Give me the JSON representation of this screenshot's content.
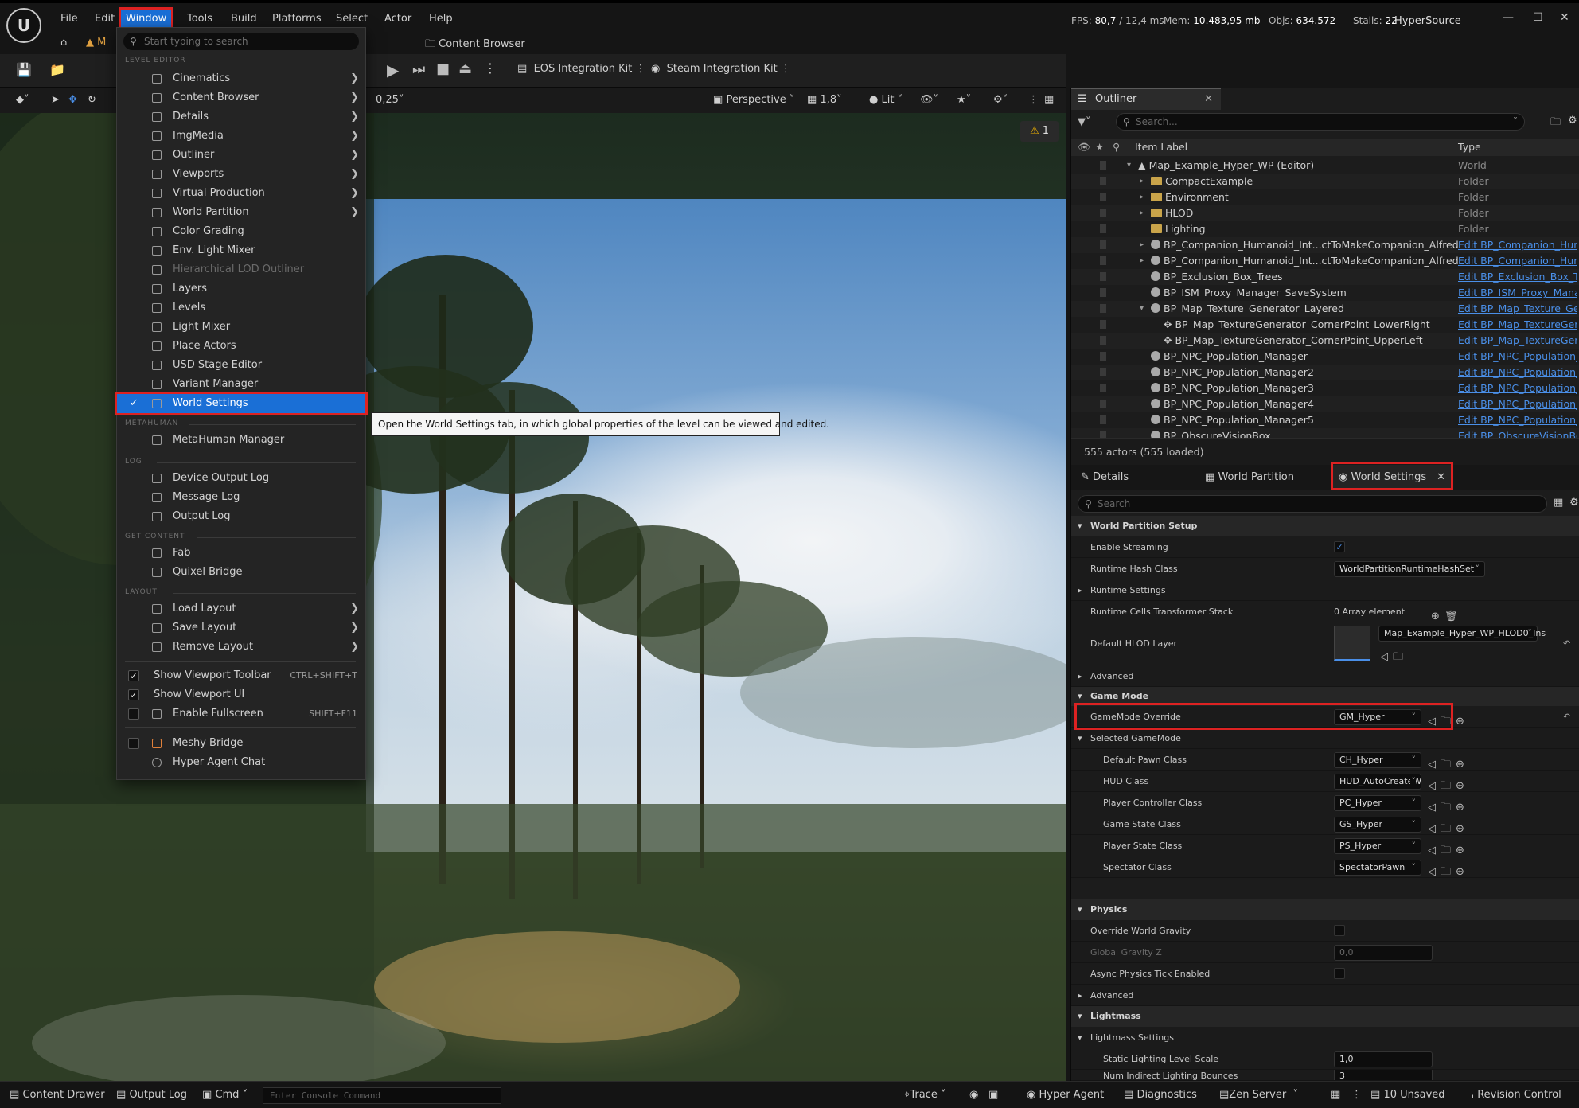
{
  "menubar": {
    "logo": "U",
    "items": [
      "File",
      "Edit",
      "Window",
      "Tools",
      "Build",
      "Platforms",
      "Select",
      "Actor",
      "Help"
    ],
    "stats": {
      "fps_label": "FPS:",
      "fps": "80,7",
      "ms": "/ 12,4 ms",
      "mem_label": "Mem:",
      "mem": "10.483,95 mb",
      "objs_label": "Objs:",
      "objs": "634.572",
      "stalls_label": "Stalls:",
      "stalls": "22"
    },
    "project": "HyperSource"
  },
  "tabs_row": {
    "map_tab": "M",
    "content_browser": "Content Browser"
  },
  "toolbar": {
    "eos": "EOS Integration Kit",
    "steam": "Steam Integration Kit"
  },
  "viewport": {
    "snap": "0,25",
    "perspective": "Perspective",
    "speed": "1,8",
    "lit": "Lit",
    "warning": "1"
  },
  "dropdown": {
    "search_placeholder": "Start typing to search",
    "sections": {
      "level_editor": "LEVEL EDITOR",
      "metahuman": "METAHUMAN",
      "log": "LOG",
      "get_content": "GET CONTENT",
      "layout": "LAYOUT"
    },
    "level_editor": [
      {
        "label": "Cinematics",
        "sub": true
      },
      {
        "label": "Content Browser",
        "sub": true
      },
      {
        "label": "Details",
        "sub": true
      },
      {
        "label": "ImgMedia",
        "sub": true
      },
      {
        "label": "Outliner",
        "sub": true
      },
      {
        "label": "Viewports",
        "sub": true
      },
      {
        "label": "Virtual Production",
        "sub": true
      },
      {
        "label": "World Partition",
        "sub": true
      },
      {
        "label": "Color Grading",
        "sub": false
      },
      {
        "label": "Env. Light Mixer",
        "sub": false
      },
      {
        "label": "Hierarchical LOD Outliner",
        "sub": false,
        "dim": true
      },
      {
        "label": "Layers",
        "sub": false
      },
      {
        "label": "Levels",
        "sub": false
      },
      {
        "label": "Light Mixer",
        "sub": false
      },
      {
        "label": "Place Actors",
        "sub": false
      },
      {
        "label": "USD Stage Editor",
        "sub": false
      },
      {
        "label": "Variant Manager",
        "sub": false
      },
      {
        "label": "World Settings",
        "sub": false,
        "selected": true
      }
    ],
    "metahuman": [
      "MetaHuman Manager"
    ],
    "log": [
      "Device Output Log",
      "Message Log",
      "Output Log"
    ],
    "get_content": [
      "Fab",
      "Quixel Bridge"
    ],
    "layout": [
      "Load Layout",
      "Save Layout",
      "Remove Layout"
    ],
    "toggles": [
      {
        "label": "Show Viewport Toolbar",
        "shortcut": "CTRL+SHIFT+T",
        "checked": true
      },
      {
        "label": "Show Viewport UI",
        "shortcut": "",
        "checked": true
      },
      {
        "label": "Enable Fullscreen",
        "shortcut": "SHIFT+F11",
        "checked": false
      }
    ],
    "extra": [
      {
        "label": "Meshy Bridge",
        "checked": false
      },
      {
        "label": "Hyper Agent Chat",
        "checked": null
      }
    ],
    "tooltip": "Open the World Settings tab, in which global properties of the level can be viewed and edited."
  },
  "outliner": {
    "tab": "Outliner",
    "search_placeholder": "Search...",
    "col_label": "Item Label",
    "col_type": "Type",
    "rows": [
      {
        "label": "Map_Example_Hyper_WP (Editor)",
        "type": "World",
        "indent": 0,
        "kind": "world",
        "link": false
      },
      {
        "label": "CompactExample",
        "type": "Folder",
        "indent": 1,
        "kind": "folder",
        "link": false
      },
      {
        "label": "Environment",
        "type": "Folder",
        "indent": 1,
        "kind": "folder",
        "link": false
      },
      {
        "label": "HLOD",
        "type": "Folder",
        "indent": 1,
        "kind": "folder",
        "link": false
      },
      {
        "label": "Lighting",
        "type": "Folder",
        "indent": 1,
        "kind": "folder",
        "link": false
      },
      {
        "label": "BP_Companion_Humanoid_Int...ctToMakeCompanion_Alfred",
        "type": "Edit BP_Companion_Humanoid",
        "indent": 1,
        "kind": "actor",
        "link": true
      },
      {
        "label": "BP_Companion_Humanoid_Int...ctToMakeCompanion_Alfred",
        "type": "Edit BP_Companion_Humanoid",
        "indent": 1,
        "kind": "actor",
        "link": true
      },
      {
        "label": "BP_Exclusion_Box_Trees",
        "type": "Edit BP_Exclusion_Box_Trees",
        "indent": 1,
        "kind": "actor",
        "link": true
      },
      {
        "label": "BP_ISM_Proxy_Manager_SaveSystem",
        "type": "Edit BP_ISM_Proxy_Manager",
        "indent": 1,
        "kind": "actor",
        "link": true
      },
      {
        "label": "BP_Map_Texture_Generator_Layered",
        "type": "Edit BP_Map_Texture_Generator",
        "indent": 1,
        "kind": "actor",
        "link": true
      },
      {
        "label": "BP_Map_TextureGenerator_CornerPoint_LowerRight",
        "type": "Edit BP_Map_TextureGenerator",
        "indent": 2,
        "kind": "point",
        "link": true
      },
      {
        "label": "BP_Map_TextureGenerator_CornerPoint_UpperLeft",
        "type": "Edit BP_Map_TextureGenerator",
        "indent": 2,
        "kind": "point",
        "link": true
      },
      {
        "label": "BP_NPC_Population_Manager",
        "type": "Edit BP_NPC_Population_Manager",
        "indent": 1,
        "kind": "actor",
        "link": true
      },
      {
        "label": "BP_NPC_Population_Manager2",
        "type": "Edit BP_NPC_Population_Manager",
        "indent": 1,
        "kind": "actor",
        "link": true
      },
      {
        "label": "BP_NPC_Population_Manager3",
        "type": "Edit BP_NPC_Population_Manager",
        "indent": 1,
        "kind": "actor",
        "link": true
      },
      {
        "label": "BP_NPC_Population_Manager4",
        "type": "Edit BP_NPC_Population_Manager",
        "indent": 1,
        "kind": "actor",
        "link": true
      },
      {
        "label": "BP_NPC_Population_Manager5",
        "type": "Edit BP_NPC_Population_Manager",
        "indent": 1,
        "kind": "actor",
        "link": true
      },
      {
        "label": "BP_ObscureVisionBox",
        "type": "Edit BP_ObscureVisionBox",
        "indent": 1,
        "kind": "actor",
        "link": true
      }
    ],
    "footer": "555 actors (555 loaded)"
  },
  "details": {
    "tabs": [
      "Details",
      "World Partition",
      "World Settings"
    ],
    "search_placeholder": "Search",
    "categories": {
      "world_partition_setup": "World Partition Setup",
      "advanced1": "Advanced",
      "game_mode": "Game Mode",
      "physics": "Physics",
      "advanced2": "Advanced",
      "lightmass": "Lightmass"
    },
    "props": {
      "enable_streaming": "Enable Streaming",
      "runtime_hash_class": "Runtime Hash Class",
      "runtime_hash_value": "WorldPartitionRuntimeHashSet",
      "runtime_settings": "Runtime Settings",
      "runtime_cells": "Runtime Cells Transformer Stack",
      "runtime_cells_value": "0 Array element",
      "default_hlod": "Default HLOD Layer",
      "default_hlod_value": "Map_Example_Hyper_WP_HLOD0_Ins",
      "gamemode_override": "GameMode Override",
      "gamemode_value": "GM_Hyper",
      "selected_gamemode": "Selected GameMode",
      "default_pawn": "Default Pawn Class",
      "default_pawn_value": "CH_Hyper",
      "hud": "HUD Class",
      "hud_value": "HUD_AutoCreateW",
      "player_controller": "Player Controller Class",
      "player_controller_value": "PC_Hyper",
      "game_state": "Game State Class",
      "game_state_value": "GS_Hyper",
      "player_state": "Player State Class",
      "player_state_value": "PS_Hyper",
      "spectator": "Spectator Class",
      "spectator_value": "SpectatorPawn",
      "override_gravity": "Override World Gravity",
      "global_gravity": "Global Gravity Z",
      "global_gravity_value": "0,0",
      "async_physics": "Async Physics Tick Enabled",
      "lightmass_settings": "Lightmass Settings",
      "static_lighting": "Static Lighting Level Scale",
      "static_lighting_value": "1,0",
      "num_bounces": "Num Indirect Lighting Bounces",
      "num_bounces_value": "3"
    }
  },
  "statusbar": {
    "content_drawer": "Content Drawer",
    "output_log": "Output Log",
    "cmd": "Cmd",
    "console_placeholder": "Enter Console Command",
    "trace": "Trace",
    "hyper_agent": "Hyper Agent",
    "diagnostics": "Diagnostics",
    "zen_server": "Zen Server",
    "unsaved": "10 Unsaved",
    "revision_control": "Revision Control"
  },
  "colors": {
    "accent": "#1a6fd6",
    "highlight_box": "#dd2222",
    "link": "#4a8fe8",
    "folder": "#c9a44a"
  }
}
